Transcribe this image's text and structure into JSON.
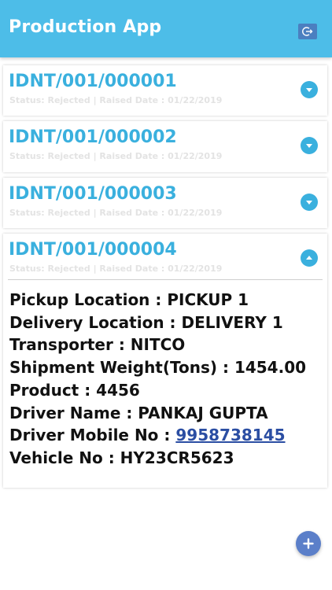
{
  "header": {
    "title": "Production App",
    "logout_icon": "logout-icon"
  },
  "cards": [
    {
      "id": "IDNT/001/000001",
      "status_line": "Status: Rejected | Raised Date : 01/22/2019",
      "expanded": false
    },
    {
      "id": "IDNT/001/000002",
      "status_line": "Status: Rejected | Raised Date : 01/22/2019",
      "expanded": false
    },
    {
      "id": "IDNT/001/000003",
      "status_line": "Status: Rejected | Raised Date : 01/22/2019",
      "expanded": false
    },
    {
      "id": "IDNT/001/000004",
      "status_line": "Status: Rejected | Raised Date : 01/22/2019",
      "expanded": true,
      "details": {
        "pickup": "Pickup Location : PICKUP 1",
        "delivery": "Delivery Location : DELIVERY 1",
        "transporter": "Transporter : NITCO",
        "weight": "Shipment Weight(Tons) : 1454.00",
        "product": "Product : 4456",
        "driver_name": "Driver Name : PANKAJ GUPTA",
        "driver_mobile_label": "Driver Mobile No : ",
        "driver_mobile": "9958738145",
        "vehicle": "Vehicle No : HY23CR5623"
      }
    }
  ],
  "fab": {
    "icon": "plus-icon"
  },
  "colors": {
    "header": "#4dbde8",
    "accent": "#3ab0de",
    "fab": "#5b7fc9",
    "link": "#2b4ea3"
  }
}
